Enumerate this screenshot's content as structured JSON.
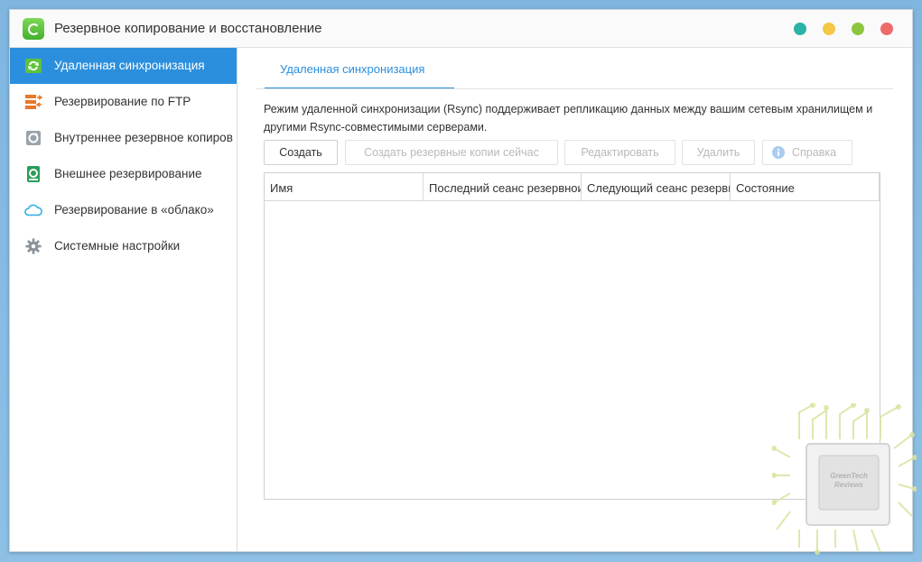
{
  "window": {
    "title": "Резервное копирование и восстановление",
    "controls": {
      "colors": [
        "#2ab3a6",
        "#f4c844",
        "#8cc63f",
        "#ef6b6b"
      ]
    }
  },
  "sidebar": {
    "items": [
      {
        "label": "Удаленная синхронизация",
        "icon": "sync-icon",
        "active": true
      },
      {
        "label": "Резервирование по FTP",
        "icon": "ftp-icon",
        "active": false
      },
      {
        "label": "Внутреннее резервное копиров",
        "icon": "internal-backup-icon",
        "active": false
      },
      {
        "label": "Внешнее резервирование",
        "icon": "external-backup-icon",
        "active": false
      },
      {
        "label": "Резервирование в «облако»",
        "icon": "cloud-icon",
        "active": false
      },
      {
        "label": "Системные настройки",
        "icon": "gear-icon",
        "active": false
      }
    ]
  },
  "main": {
    "tab": "Удаленная синхронизация",
    "description": "Режим удаленной синхронизации (Rsync) поддерживает репликацию данных между вашим сетевым хранилищем и другими Rsync-совместимыми серверами.",
    "toolbar": {
      "create": "Создать",
      "backup_now": "Создать резервные копии сейчас",
      "edit": "Редактировать",
      "delete": "Удалить",
      "help": "Справка"
    },
    "table": {
      "columns": [
        "Имя",
        "Последний сеанс резервнои",
        "Следующий сеанс резерви",
        "Состояние"
      ],
      "rows": []
    }
  },
  "watermark": {
    "line1": "GreenTech",
    "line2": "Reviews"
  },
  "colors": {
    "accent": "#2b8fde",
    "desktop": "#8ec0e6"
  }
}
